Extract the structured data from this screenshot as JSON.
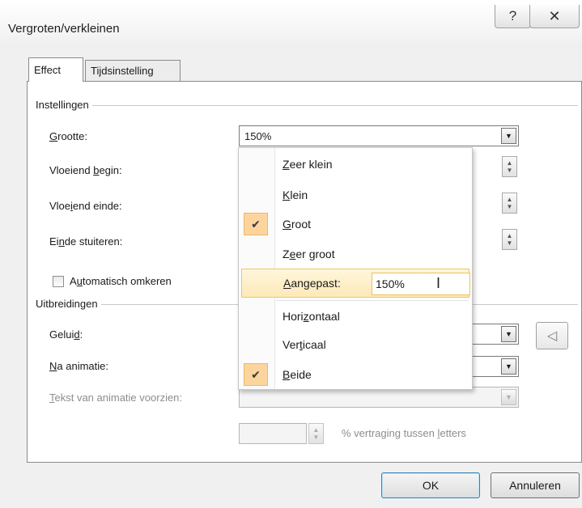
{
  "window": {
    "title": "Vergroten/verkleinen",
    "help_glyph": "?",
    "close_glyph": "✕"
  },
  "tabs": [
    {
      "label": "Effect",
      "active": true
    },
    {
      "label": "Tijdsinstelling",
      "active": false
    }
  ],
  "settings": {
    "group_label": "Instellingen",
    "size": {
      "label_pre": "",
      "label_ul": "G",
      "label_post": "rootte:",
      "value": "150%"
    },
    "smooth_start": {
      "label_pre": "Vloeiend ",
      "label_ul": "b",
      "label_post": "egin:"
    },
    "smooth_end": {
      "label_pre": "Vloe",
      "label_ul": "i",
      "label_post": "end einde:"
    },
    "bounce_end": {
      "label_pre": "Ei",
      "label_ul": "n",
      "label_post": "de stuiteren:"
    },
    "auto_reverse": {
      "label_pre": "A",
      "label_ul": "u",
      "label_post": "tomatisch omkeren",
      "checked": false
    }
  },
  "enhancements": {
    "group_label": "Uitbreidingen",
    "sound": {
      "label_pre": "Gelui",
      "label_ul": "d",
      "label_post": ":"
    },
    "after_animation": {
      "label_pre": "",
      "label_ul": "N",
      "label_post": "a animatie:"
    },
    "animate_text": {
      "label_pre": "",
      "label_ul": "T",
      "label_post": "ekst van animatie voorzien:"
    },
    "delay_label_pre": "% vertraging tussen ",
    "delay_label_ul": "l",
    "delay_label_post": "etters"
  },
  "size_menu": {
    "items": [
      {
        "pre": "",
        "ul": "Z",
        "post": "eer klein",
        "checked": false
      },
      {
        "pre": "",
        "ul": "K",
        "post": "lein",
        "checked": false
      },
      {
        "pre": "",
        "ul": "G",
        "post": "root",
        "checked": true
      },
      {
        "pre": "Z",
        "ul": "e",
        "post": "er groot",
        "checked": false
      },
      {
        "pre": "",
        "ul": "A",
        "post": "angepast:",
        "checked": false,
        "highlighted": true,
        "input_value": "150%"
      },
      {
        "pre": "Hori",
        "ul": "z",
        "post": "ontaal",
        "checked": false
      },
      {
        "pre": "Ver",
        "ul": "t",
        "post": "icaal",
        "checked": false
      },
      {
        "pre": "",
        "ul": "B",
        "post": "eide",
        "checked": true
      }
    ],
    "check_glyph": "✔"
  },
  "footer": {
    "ok_label": "OK",
    "cancel_label": "Annuleren"
  },
  "icons": {
    "sound": "speaker-icon"
  }
}
